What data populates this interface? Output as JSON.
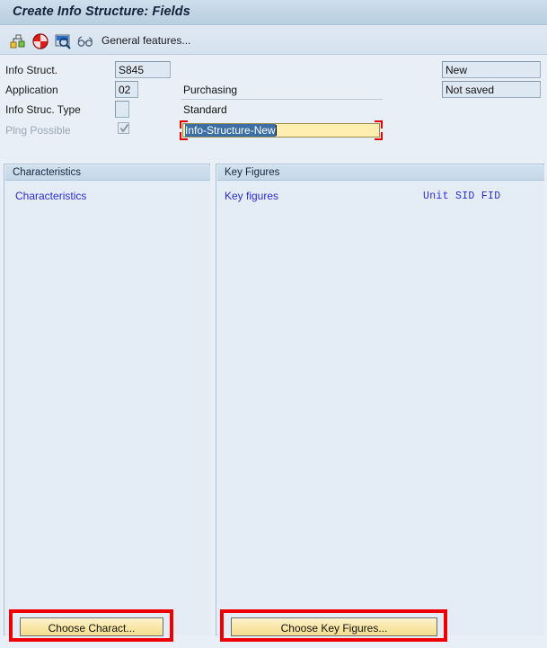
{
  "window": {
    "title": "Create Info Structure: Fields"
  },
  "toolbar": {
    "icons": [
      {
        "name": "structure-icon"
      },
      {
        "name": "cancel-icon"
      },
      {
        "name": "display-icon"
      },
      {
        "name": "glasses-icon"
      }
    ],
    "general_features_label": "General features..."
  },
  "form": {
    "info_struct_label": "Info Struct.",
    "info_struct_value": "S845",
    "description_value_selected": "Info-Structure-New",
    "status_value": "New",
    "application_label": "Application",
    "application_value": "02",
    "application_text": "Purchasing",
    "save_status_value": "Not saved",
    "info_struc_type_label": "Info Struc. Type",
    "info_struc_type_value": "",
    "info_struc_type_text": "Standard",
    "plng_possible_label": "Plng Possible",
    "plng_possible_checked": true
  },
  "characteristics_panel": {
    "header": "Characteristics",
    "column_header": "Characteristics",
    "button_label": "Choose Charact..."
  },
  "key_figures_panel": {
    "header": "Key Figures",
    "column_header": "Key figures",
    "column_header_right": "Unit SID FID",
    "button_label": "Choose Key Figures..."
  },
  "colors": {
    "accent_blue": "#2b2bd0",
    "highlight_yellow": "#ffeeb0",
    "selection_blue": "#3a6ea5",
    "marker_red": "#ee0000",
    "button_yellow": "#f8e6a4",
    "window_bg": "#e8eff7"
  }
}
